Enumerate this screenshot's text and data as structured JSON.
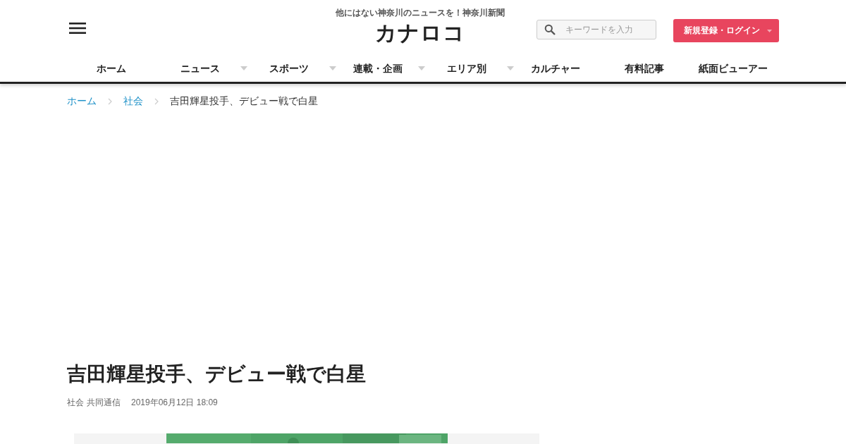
{
  "header": {
    "tagline": "他にはない神奈川のニュースを！神奈川新聞",
    "logo": "カナロコ",
    "search": {
      "placeholder": "キーワードを入力"
    },
    "login_button": "新規登録・ログイン"
  },
  "nav": [
    {
      "label": "ホーム",
      "kind": "link"
    },
    {
      "label": "ニュース",
      "kind": "menu"
    },
    {
      "label": "スポーツ",
      "kind": "menu"
    },
    {
      "label": "連載・企画",
      "kind": "menu"
    },
    {
      "label": "エリア別",
      "kind": "menu"
    },
    {
      "label": "カルチャー",
      "kind": "link"
    },
    {
      "label": "有料記事",
      "kind": "link"
    },
    {
      "label": "紙面ビューアー",
      "kind": "link"
    }
  ],
  "breadcrumb": [
    {
      "label": "ホーム",
      "kind": "link"
    },
    {
      "label": "社会",
      "kind": "link"
    },
    {
      "label": "吉田輝星投手、デビュー戦で白星",
      "kind": "current"
    }
  ],
  "article": {
    "title": "吉田輝星投手、デビュー戦で白星",
    "category": "社会",
    "source": "共同通信",
    "date": "2019年06月12日 18:09"
  }
}
